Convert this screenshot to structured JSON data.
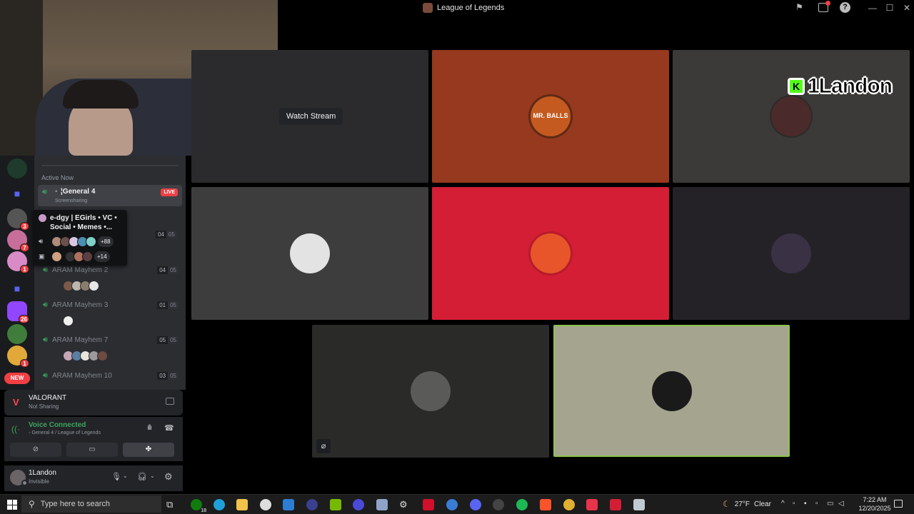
{
  "titlebar": {
    "title": "League of Legends"
  },
  "channels": {
    "section_label": "Active Now",
    "active_channel": {
      "name": "¦General 4",
      "prefix": "◦",
      "sub": "Screensharing",
      "badge": "LIVE"
    },
    "voice_rooms": [
      {
        "name": "ARAM Mayhem 2",
        "count": "04",
        "limit": "05"
      },
      {
        "name": "ARAM Mayhem 3",
        "count": "01",
        "limit": "05"
      },
      {
        "name": "ARAM Mayhem 7",
        "count": "05",
        "limit": "05"
      },
      {
        "name": "ARAM Mayhem 10",
        "count": "03",
        "limit": "05"
      }
    ],
    "hidden_room": {
      "count": "04",
      "limit": "05"
    }
  },
  "popup": {
    "server_name": "e-dgy | EGirls • VC • Social • Memes •...",
    "voice_more": "+88",
    "stream_more": "+14"
  },
  "rail": {
    "badges": [
      "3",
      "7",
      "1",
      "26",
      "1"
    ],
    "new_label": "NEW"
  },
  "activity": {
    "game": "VALORANT",
    "status": "Not Sharing"
  },
  "voice": {
    "status": "Voice Connected",
    "location": "◦ General 4 / League of Legends"
  },
  "user": {
    "name": "1Landon",
    "status": "Invisible"
  },
  "stage": {
    "watch_stream": "Watch Stream",
    "overlay_name": "1Landon",
    "tiles": [
      {
        "id": "t1",
        "bg": "#2b2b2d"
      },
      {
        "id": "t2",
        "bg": "#96391f"
      },
      {
        "id": "t3",
        "bg": "#3b3a38"
      },
      {
        "id": "t4",
        "bg": "#3d3d3e"
      },
      {
        "id": "t5",
        "bg": "#d31e36"
      },
      {
        "id": "t6",
        "bg": "#242227"
      },
      {
        "id": "t7",
        "bg": "#2a2a29"
      },
      {
        "id": "t8",
        "bg": "#a5a58f"
      }
    ],
    "avatar_text_t2": "MR. BALLS"
  },
  "taskbar": {
    "search_placeholder": "Type here to search",
    "temperature": "27°F",
    "weather": "Clear",
    "time": "7:22 AM",
    "date": "12/20/2025",
    "xbox_badge": "18"
  },
  "colors": {
    "accent_green": "#3ba55d",
    "live_red": "#ed4245",
    "blurple": "#5865f2",
    "speaking_ring": "#8bc34a"
  }
}
